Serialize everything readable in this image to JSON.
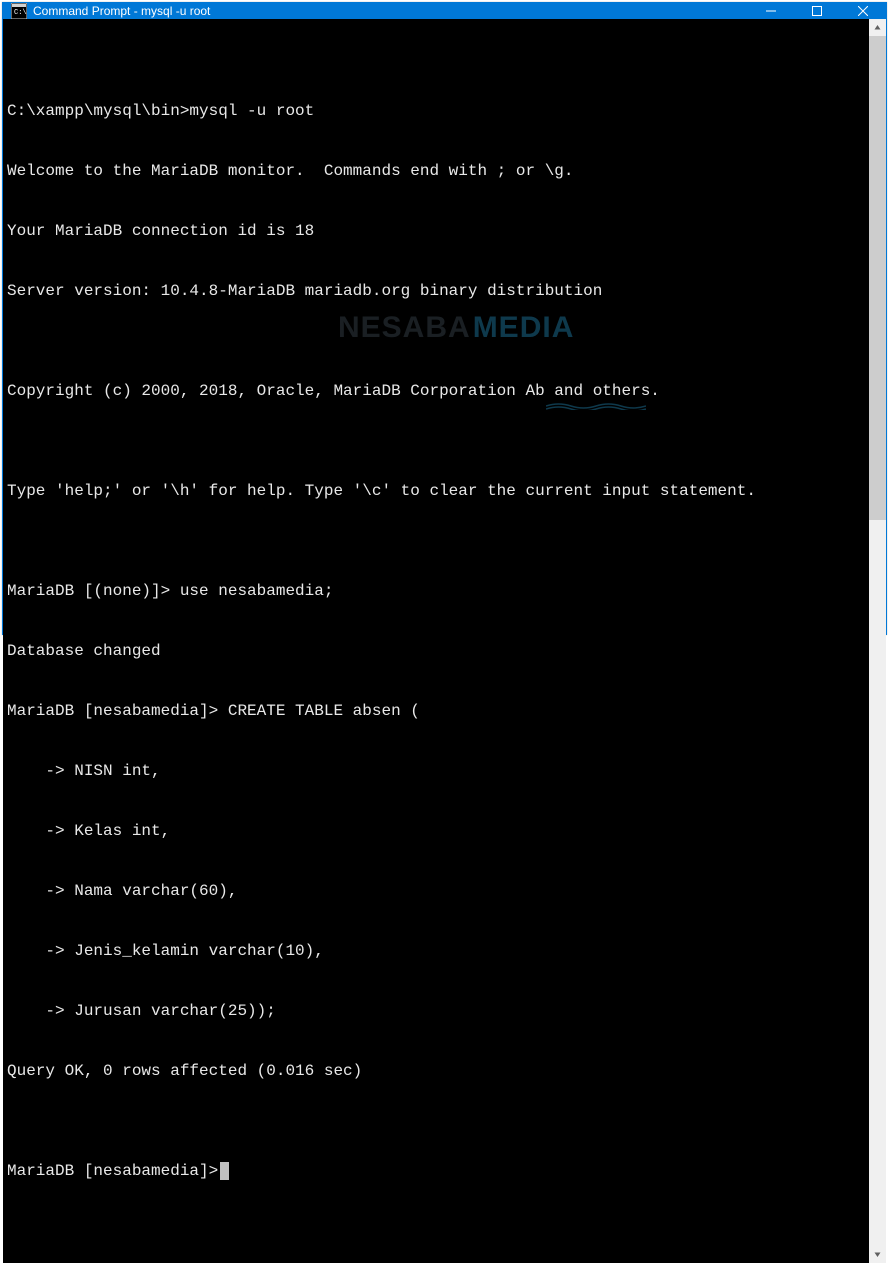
{
  "window": {
    "title": "Command Prompt - mysql  -u root"
  },
  "terminal": {
    "lines": [
      "",
      "C:\\xampp\\mysql\\bin>mysql -u root",
      "Welcome to the MariaDB monitor.  Commands end with ; or \\g.",
      "Your MariaDB connection id is 18",
      "Server version: 10.4.8-MariaDB mariadb.org binary distribution",
      "",
      "Copyright (c) 2000, 2018, Oracle, MariaDB Corporation Ab and others.",
      "",
      "Type 'help;' or '\\h' for help. Type '\\c' to clear the current input statement.",
      "",
      "MariaDB [(none)]> use nesabamedia;",
      "Database changed",
      "MariaDB [nesabamedia]> CREATE TABLE absen (",
      "    -> NISN int,",
      "    -> Kelas int,",
      "    -> Nama varchar(60),",
      "    -> Jenis_kelamin varchar(10),",
      "    -> Jurusan varchar(25));",
      "Query OK, 0 rows affected (0.016 sec)",
      "",
      "MariaDB [nesabamedia]>"
    ]
  },
  "watermark": {
    "part1": "NESABA",
    "part2": "MEDIA"
  }
}
